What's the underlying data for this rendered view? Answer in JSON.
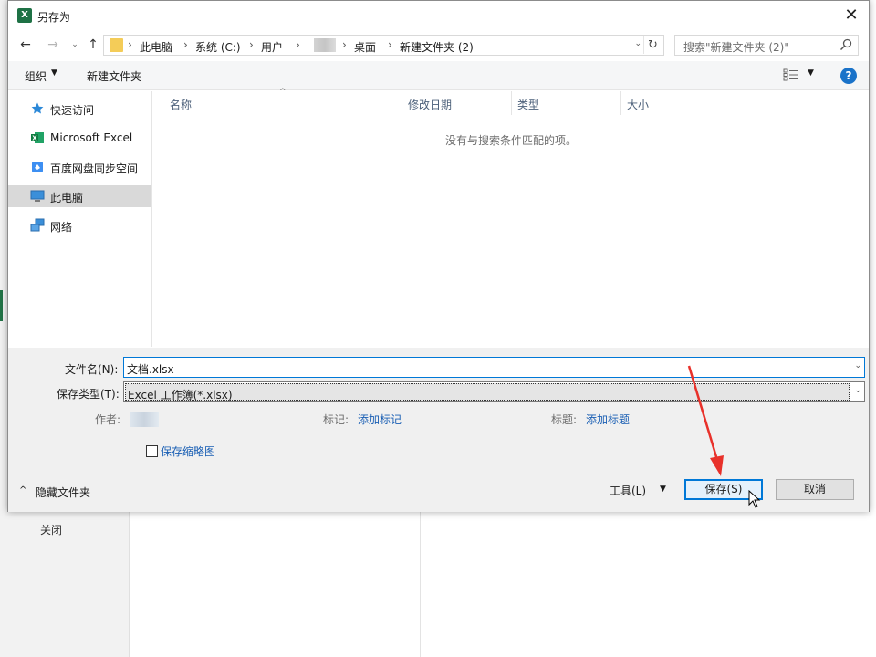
{
  "dialog": {
    "title": "另存为",
    "close_glyph": "✕",
    "app_icon_letter": "X"
  },
  "nav": {
    "back": "←",
    "forward": "→",
    "recent": "⌄",
    "up": "↑",
    "breadcrumbs": [
      "此电脑",
      "系统 (C:)",
      "用户",
      "桌面",
      "新建文件夹 (2)"
    ],
    "separator": "›",
    "dropdown": "⌄",
    "refresh": "↻",
    "search_placeholder": "搜索\"新建文件夹 (2)\""
  },
  "toolbar": {
    "organize": "组织",
    "organize_caret": "▼",
    "new_folder": "新建文件夹",
    "view_caret": "▼",
    "help": "?"
  },
  "sidebar": {
    "items": [
      {
        "label": "快速访问",
        "icon": "star-icon",
        "selected": false
      },
      {
        "label": "Microsoft Excel",
        "icon": "excel-icon",
        "selected": false
      },
      {
        "label": "百度网盘同步空间",
        "icon": "baidu-cloud-icon",
        "selected": false
      },
      {
        "label": "此电脑",
        "icon": "computer-icon",
        "selected": true
      },
      {
        "label": "网络",
        "icon": "network-icon",
        "selected": false
      }
    ]
  },
  "filelist": {
    "columns": [
      "名称",
      "修改日期",
      "类型",
      "大小"
    ],
    "sort_indicator": "^",
    "empty_message": "没有与搜索条件匹配的项。"
  },
  "form": {
    "filename_label": "文件名(N):",
    "filename_value": "文档.xlsx",
    "filetype_label": "保存类型(T):",
    "filetype_value": "Excel 工作簿(*.xlsx)",
    "author_label": "作者:",
    "tags_label": "标记:",
    "tags_link": "添加标记",
    "title_label": "标题:",
    "title_link": "添加标题",
    "thumbnail_label": "保存缩略图",
    "thumbnail_checked": false,
    "hide_folders_caret": "^",
    "hide_folders": "隐藏文件夹",
    "tools": "工具(L)",
    "tools_caret": "▼",
    "save": "保存(S)",
    "cancel": "取消",
    "field_caret": "⌄"
  },
  "background": {
    "close_label": "关闭"
  },
  "colors": {
    "accent": "#0078d7",
    "excel_green": "#1e7145",
    "link": "#1a5fb4",
    "annotation_arrow": "#e8312a"
  }
}
